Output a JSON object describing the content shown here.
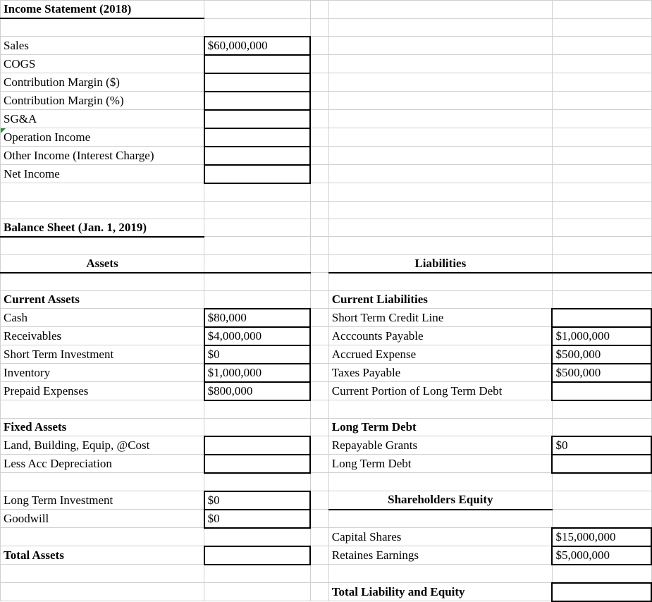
{
  "income_statement": {
    "title": "Income Statement (2018)",
    "rows": {
      "sales_label": "Sales",
      "sales_value": "$60,000,000",
      "cogs_label": "COGS",
      "cm_dollars_label": "Contribution Margin ($)",
      "cm_pct_label": "Contribution Margin (%)",
      "sga_label": "SG&A",
      "op_income_label": "Operation Income",
      "other_income_label": "Other Income (Interest Charge)",
      "net_income_label": "Net Income"
    }
  },
  "balance_sheet": {
    "title": "Balance Sheet (Jan. 1, 2019)",
    "assets_header": "Assets",
    "liabilities_header": "Liabilities",
    "current_assets_header": "Current Assets",
    "current_liabilities_header": "Current Liabilities",
    "cash_label": "Cash",
    "cash_value": "$80,000",
    "receivables_label": "Receivables",
    "receivables_value": "$4,000,000",
    "sti_label": "Short Term Investment",
    "sti_value": "$0",
    "inventory_label": "Inventory",
    "inventory_value": "$1,000,000",
    "prepaid_label": "Prepaid Expenses",
    "prepaid_value": "$800,000",
    "stcl_label": "Short Term Credit Line",
    "ap_label": "Acccounts Payable",
    "ap_value": "$1,000,000",
    "accrued_label": "Accrued Expense",
    "accrued_value": "$500,000",
    "taxes_label": "Taxes Payable",
    "taxes_value": "$500,000",
    "cpltd_label": "Current Portion of Long Term Debt",
    "fixed_assets_header": "Fixed Assets",
    "ltd_header": "Long Term Debt",
    "lbe_label": "Land, Building, Equip, @Cost",
    "repayable_label": "Repayable Grants",
    "repayable_value": "$0",
    "less_dep_label": "Less Acc Depreciation",
    "ltd_label": "Long Term Debt",
    "lti_label": "Long Term Investment",
    "lti_value": "$0",
    "se_header": "Shareholders Equity",
    "goodwill_label": "Goodwill",
    "goodwill_value": "$0",
    "capital_label": "Capital Shares",
    "capital_value": "$15,000,000",
    "total_assets_label": "Total Assets",
    "retained_label": "Retaines Earnings",
    "retained_value": "$5,000,000",
    "total_le_label": "Total Liability and Equity"
  }
}
